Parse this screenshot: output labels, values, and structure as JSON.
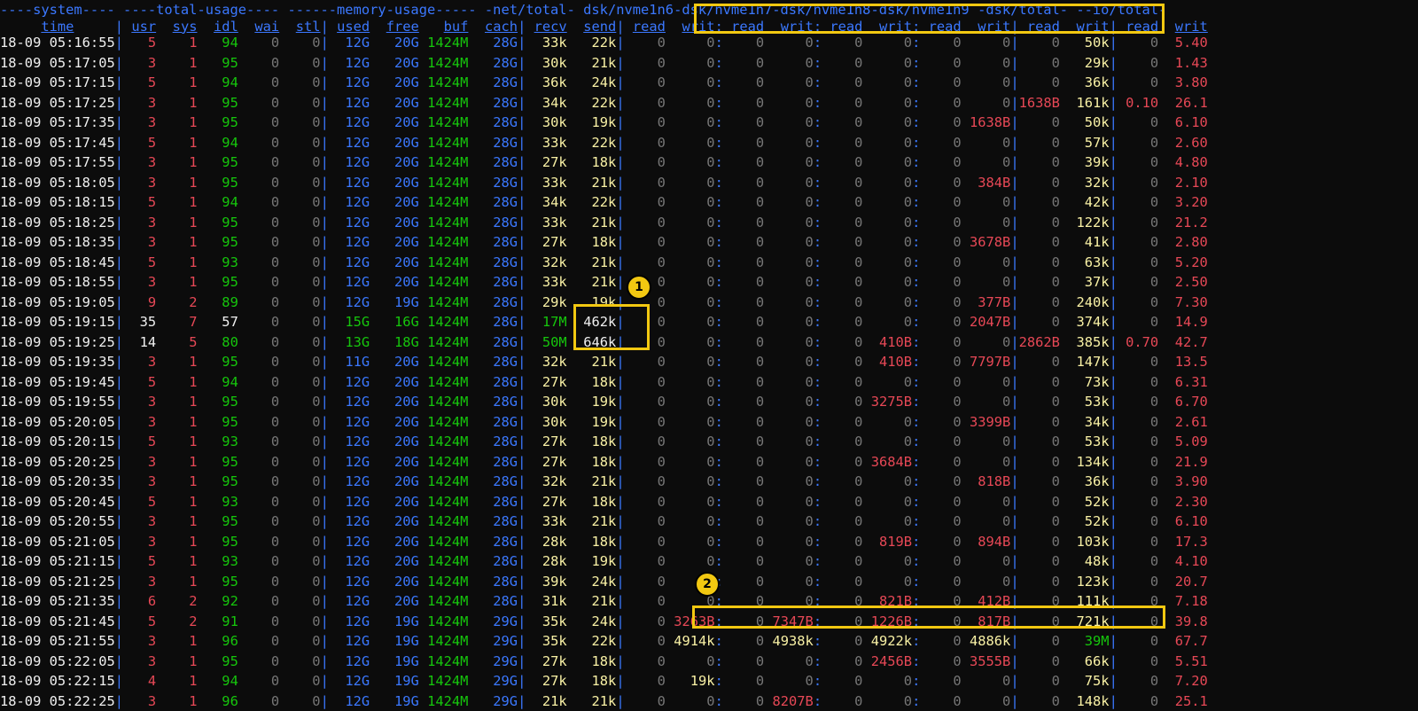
{
  "header": {
    "groups": [
      {
        "text": "----system----",
        "color": "blu"
      },
      {
        "text": "----total-usage----",
        "color": "blu"
      },
      {
        "text": "------memory-usage-----",
        "color": "blu"
      },
      {
        "text": "-net/total-",
        "color": "blu"
      },
      {
        "text": "dsk/nvme1n6-dsk/nvme1n7-dsk/nvme1n8-dsk/nvme1n9",
        "color": "blu"
      },
      {
        "text": "-dsk/total-",
        "color": "blu"
      },
      {
        "text": "--io/total-",
        "color": "blu"
      }
    ],
    "columns": [
      "time",
      "usr",
      "sys",
      "idl",
      "wai",
      "stl",
      "used",
      "free",
      "buf",
      "cach",
      "recv",
      "send",
      "read",
      "writ",
      "read",
      "writ",
      "read",
      "writ",
      "read",
      "writ",
      "read",
      "writ",
      "read",
      "writ"
    ]
  },
  "rows": [
    [
      "18-09 05:16:55",
      "5",
      "1",
      "94",
      "0",
      "0",
      "12G",
      "20G",
      "1424M",
      "28G",
      "33k",
      "22k",
      "0",
      "0",
      "0",
      "0",
      "0",
      "0",
      "0",
      "0",
      "0",
      "50k",
      "0",
      "5.40"
    ],
    [
      "18-09 05:17:05",
      "3",
      "1",
      "95",
      "0",
      "0",
      "12G",
      "20G",
      "1424M",
      "28G",
      "30k",
      "21k",
      "0",
      "0",
      "0",
      "0",
      "0",
      "0",
      "0",
      "0",
      "0",
      "29k",
      "0",
      "1.43"
    ],
    [
      "18-09 05:17:15",
      "5",
      "1",
      "94",
      "0",
      "0",
      "12G",
      "20G",
      "1424M",
      "28G",
      "36k",
      "24k",
      "0",
      "0",
      "0",
      "0",
      "0",
      "0",
      "0",
      "0",
      "0",
      "36k",
      "0",
      "3.80"
    ],
    [
      "18-09 05:17:25",
      "3",
      "1",
      "95",
      "0",
      "0",
      "12G",
      "20G",
      "1424M",
      "28G",
      "34k",
      "22k",
      "0",
      "0",
      "0",
      "0",
      "0",
      "0",
      "0",
      "0",
      "1638B",
      "161k",
      "0.10",
      "26.1"
    ],
    [
      "18-09 05:17:35",
      "3",
      "1",
      "95",
      "0",
      "0",
      "12G",
      "20G",
      "1424M",
      "28G",
      "30k",
      "19k",
      "0",
      "0",
      "0",
      "0",
      "0",
      "0",
      "0",
      "1638B",
      "0",
      "50k",
      "0",
      "6.10"
    ],
    [
      "18-09 05:17:45",
      "5",
      "1",
      "94",
      "0",
      "0",
      "12G",
      "20G",
      "1424M",
      "28G",
      "33k",
      "22k",
      "0",
      "0",
      "0",
      "0",
      "0",
      "0",
      "0",
      "0",
      "0",
      "57k",
      "0",
      "2.60"
    ],
    [
      "18-09 05:17:55",
      "3",
      "1",
      "95",
      "0",
      "0",
      "12G",
      "20G",
      "1424M",
      "28G",
      "27k",
      "18k",
      "0",
      "0",
      "0",
      "0",
      "0",
      "0",
      "0",
      "0",
      "0",
      "39k",
      "0",
      "4.80"
    ],
    [
      "18-09 05:18:05",
      "3",
      "1",
      "95",
      "0",
      "0",
      "12G",
      "20G",
      "1424M",
      "28G",
      "33k",
      "21k",
      "0",
      "0",
      "0",
      "0",
      "0",
      "0",
      "0",
      "384B",
      "0",
      "32k",
      "0",
      "2.10"
    ],
    [
      "18-09 05:18:15",
      "5",
      "1",
      "94",
      "0",
      "0",
      "12G",
      "20G",
      "1424M",
      "28G",
      "34k",
      "22k",
      "0",
      "0",
      "0",
      "0",
      "0",
      "0",
      "0",
      "0",
      "0",
      "42k",
      "0",
      "3.20"
    ],
    [
      "18-09 05:18:25",
      "3",
      "1",
      "95",
      "0",
      "0",
      "12G",
      "20G",
      "1424M",
      "28G",
      "33k",
      "21k",
      "0",
      "0",
      "0",
      "0",
      "0",
      "0",
      "0",
      "0",
      "0",
      "122k",
      "0",
      "21.2"
    ],
    [
      "18-09 05:18:35",
      "3",
      "1",
      "95",
      "0",
      "0",
      "12G",
      "20G",
      "1424M",
      "28G",
      "27k",
      "18k",
      "0",
      "0",
      "0",
      "0",
      "0",
      "0",
      "0",
      "3678B",
      "0",
      "41k",
      "0",
      "2.80"
    ],
    [
      "18-09 05:18:45",
      "5",
      "1",
      "93",
      "0",
      "0",
      "12G",
      "20G",
      "1424M",
      "28G",
      "32k",
      "21k",
      "0",
      "0",
      "0",
      "0",
      "0",
      "0",
      "0",
      "0",
      "0",
      "63k",
      "0",
      "5.20"
    ],
    [
      "18-09 05:18:55",
      "3",
      "1",
      "95",
      "0",
      "0",
      "12G",
      "20G",
      "1424M",
      "28G",
      "33k",
      "21k",
      "0",
      "0",
      "0",
      "0",
      "0",
      "0",
      "0",
      "0",
      "0",
      "37k",
      "0",
      "2.50"
    ],
    [
      "18-09 05:19:05",
      "9",
      "2",
      "89",
      "0",
      "0",
      "12G",
      "19G",
      "1424M",
      "28G",
      "29k",
      "19k",
      "0",
      "0",
      "0",
      "0",
      "0",
      "0",
      "0",
      "377B",
      "0",
      "240k",
      "0",
      "7.30"
    ],
    [
      "18-09 05:19:15",
      "35",
      "7",
      "57",
      "0",
      "0",
      "15G",
      "16G",
      "1424M",
      "28G",
      "17M",
      "462k",
      "0",
      "0",
      "0",
      "0",
      "0",
      "0",
      "0",
      "2047B",
      "0",
      "374k",
      "0",
      "14.9"
    ],
    [
      "18-09 05:19:25",
      "14",
      "5",
      "80",
      "0",
      "0",
      "13G",
      "18G",
      "1424M",
      "28G",
      "50M",
      "646k",
      "0",
      "0",
      "0",
      "0",
      "0",
      "410B",
      "0",
      "0",
      "2862B",
      "385k",
      "0.70",
      "42.7"
    ],
    [
      "18-09 05:19:35",
      "3",
      "1",
      "95",
      "0",
      "0",
      "11G",
      "20G",
      "1424M",
      "28G",
      "32k",
      "21k",
      "0",
      "0",
      "0",
      "0",
      "0",
      "410B",
      "0",
      "7797B",
      "0",
      "147k",
      "0",
      "13.5"
    ],
    [
      "18-09 05:19:45",
      "5",
      "1",
      "94",
      "0",
      "0",
      "12G",
      "20G",
      "1424M",
      "28G",
      "27k",
      "18k",
      "0",
      "0",
      "0",
      "0",
      "0",
      "0",
      "0",
      "0",
      "0",
      "73k",
      "0",
      "6.31"
    ],
    [
      "18-09 05:19:55",
      "3",
      "1",
      "95",
      "0",
      "0",
      "12G",
      "20G",
      "1424M",
      "28G",
      "30k",
      "19k",
      "0",
      "0",
      "0",
      "0",
      "0",
      "3275B",
      "0",
      "0",
      "0",
      "53k",
      "0",
      "6.70"
    ],
    [
      "18-09 05:20:05",
      "3",
      "1",
      "95",
      "0",
      "0",
      "12G",
      "20G",
      "1424M",
      "28G",
      "30k",
      "19k",
      "0",
      "0",
      "0",
      "0",
      "0",
      "0",
      "0",
      "3399B",
      "0",
      "34k",
      "0",
      "2.61"
    ],
    [
      "18-09 05:20:15",
      "5",
      "1",
      "93",
      "0",
      "0",
      "12G",
      "20G",
      "1424M",
      "28G",
      "27k",
      "18k",
      "0",
      "0",
      "0",
      "0",
      "0",
      "0",
      "0",
      "0",
      "0",
      "53k",
      "0",
      "5.09"
    ],
    [
      "18-09 05:20:25",
      "3",
      "1",
      "95",
      "0",
      "0",
      "12G",
      "20G",
      "1424M",
      "28G",
      "27k",
      "18k",
      "0",
      "0",
      "0",
      "0",
      "0",
      "3684B",
      "0",
      "0",
      "0",
      "134k",
      "0",
      "21.9"
    ],
    [
      "18-09 05:20:35",
      "3",
      "1",
      "95",
      "0",
      "0",
      "12G",
      "20G",
      "1424M",
      "28G",
      "32k",
      "21k",
      "0",
      "0",
      "0",
      "0",
      "0",
      "0",
      "0",
      "818B",
      "0",
      "36k",
      "0",
      "3.90"
    ],
    [
      "18-09 05:20:45",
      "5",
      "1",
      "93",
      "0",
      "0",
      "12G",
      "20G",
      "1424M",
      "28G",
      "27k",
      "18k",
      "0",
      "0",
      "0",
      "0",
      "0",
      "0",
      "0",
      "0",
      "0",
      "52k",
      "0",
      "2.30"
    ],
    [
      "18-09 05:20:55",
      "3",
      "1",
      "95",
      "0",
      "0",
      "12G",
      "20G",
      "1424M",
      "28G",
      "33k",
      "21k",
      "0",
      "0",
      "0",
      "0",
      "0",
      "0",
      "0",
      "0",
      "0",
      "52k",
      "0",
      "6.10"
    ],
    [
      "18-09 05:21:05",
      "3",
      "1",
      "95",
      "0",
      "0",
      "12G",
      "20G",
      "1424M",
      "28G",
      "28k",
      "18k",
      "0",
      "0",
      "0",
      "0",
      "0",
      "819B",
      "0",
      "894B",
      "0",
      "103k",
      "0",
      "17.3"
    ],
    [
      "18-09 05:21:15",
      "5",
      "1",
      "93",
      "0",
      "0",
      "12G",
      "20G",
      "1424M",
      "28G",
      "28k",
      "19k",
      "0",
      "0",
      "0",
      "0",
      "0",
      "0",
      "0",
      "0",
      "0",
      "48k",
      "0",
      "4.10"
    ],
    [
      "18-09 05:21:25",
      "3",
      "1",
      "95",
      "0",
      "0",
      "12G",
      "20G",
      "1424M",
      "28G",
      "39k",
      "24k",
      "0",
      "0",
      "0",
      "0",
      "0",
      "0",
      "0",
      "0",
      "0",
      "123k",
      "0",
      "20.7"
    ],
    [
      "18-09 05:21:35",
      "6",
      "2",
      "92",
      "0",
      "0",
      "12G",
      "20G",
      "1424M",
      "28G",
      "31k",
      "21k",
      "0",
      "0",
      "0",
      "0",
      "0",
      "821B",
      "0",
      "412B",
      "0",
      "111k",
      "0",
      "7.18"
    ],
    [
      "18-09 05:21:45",
      "5",
      "2",
      "91",
      "0",
      "0",
      "12G",
      "19G",
      "1424M",
      "29G",
      "35k",
      "24k",
      "0",
      "3263B",
      "0",
      "7347B",
      "0",
      "1226B",
      "0",
      "817B",
      "0",
      "721k",
      "0",
      "39.8"
    ],
    [
      "18-09 05:21:55",
      "3",
      "1",
      "96",
      "0",
      "0",
      "12G",
      "19G",
      "1424M",
      "29G",
      "35k",
      "22k",
      "0",
      "4914k",
      "0",
      "4938k",
      "0",
      "4922k",
      "0",
      "4886k",
      "0",
      "39M",
      "0",
      "67.7"
    ],
    [
      "18-09 05:22:05",
      "3",
      "1",
      "95",
      "0",
      "0",
      "12G",
      "19G",
      "1424M",
      "29G",
      "27k",
      "18k",
      "0",
      "0",
      "0",
      "0",
      "0",
      "2456B",
      "0",
      "3555B",
      "0",
      "66k",
      "0",
      "5.51"
    ],
    [
      "18-09 05:22:15",
      "4",
      "1",
      "94",
      "0",
      "0",
      "12G",
      "19G",
      "1424M",
      "29G",
      "27k",
      "18k",
      "0",
      "19k",
      "0",
      "0",
      "0",
      "0",
      "0",
      "0",
      "0",
      "75k",
      "0",
      "7.20"
    ],
    [
      "18-09 05:22:25",
      "3",
      "1",
      "96",
      "0",
      "0",
      "12G",
      "19G",
      "1424M",
      "29G",
      "21k",
      "21k",
      "0",
      "0",
      "0",
      "8207B",
      "0",
      "0",
      "0",
      "0",
      "0",
      "148k",
      "0",
      "25.1"
    ]
  ],
  "annotations": [
    {
      "label": "1"
    },
    {
      "label": "2"
    }
  ]
}
